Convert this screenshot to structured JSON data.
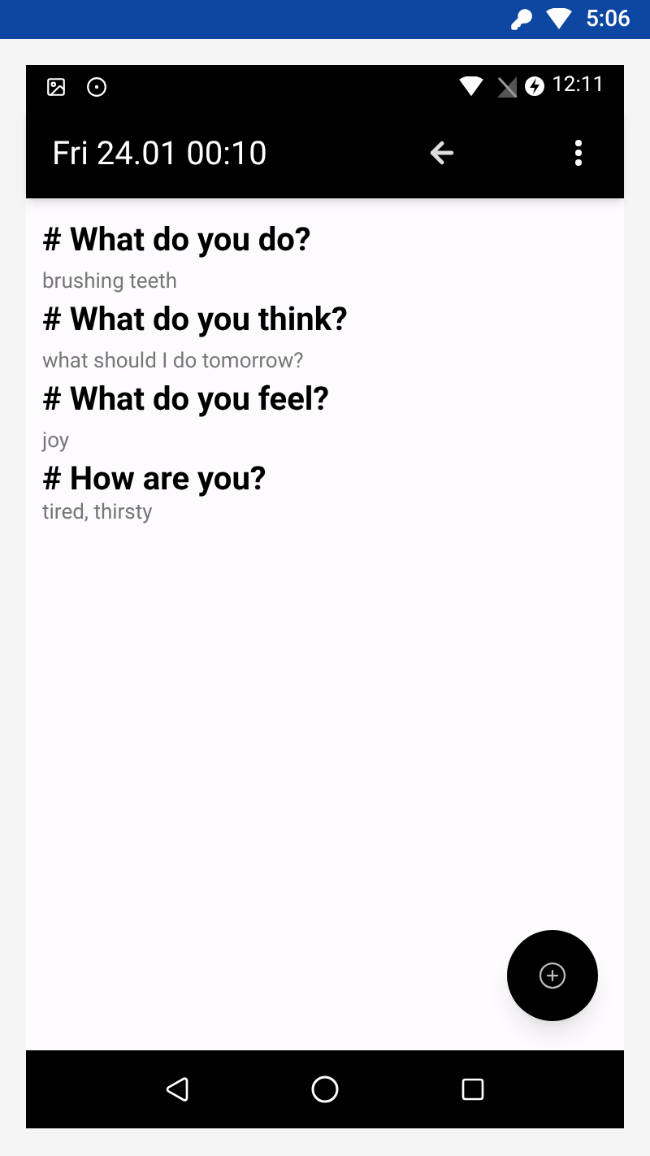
{
  "device_status_bar": {
    "time": "5:06"
  },
  "app_status_bar": {
    "time": "12:11"
  },
  "toolbar": {
    "title": "Fri 24.01 00:10"
  },
  "entries": [
    {
      "question": "# What do you do?",
      "answer": "brushing teeth"
    },
    {
      "question": "# What do you think?",
      "answer": "what should I do tomorrow?"
    },
    {
      "question": "# What do you feel?",
      "answer": "joy"
    },
    {
      "question": "# How are you?",
      "answer": "tired, thirsty"
    }
  ]
}
